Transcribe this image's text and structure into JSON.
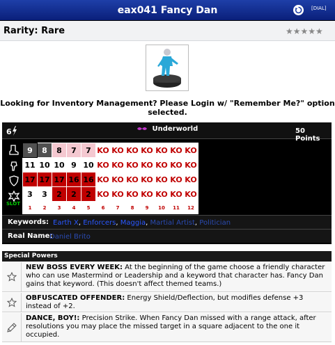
{
  "header": {
    "title": "eax041 Fancy Dan",
    "dial_label": "[DIAL]"
  },
  "rarity": {
    "text": "Rarity: Rare",
    "stars": "★★★★★"
  },
  "notice": {
    "line1": "Looking for Inventory Management? Please Login w/ \"Remember Me?\" option",
    "line2": "selected."
  },
  "dial": {
    "points_range": "6",
    "team": "Underworld",
    "cost": "50 Points",
    "slot_label": "SLOT",
    "rows": [
      [
        "9",
        "8",
        "8",
        "7",
        "7",
        "KO",
        "KO",
        "KO",
        "KO",
        "KO",
        "KO",
        "KO"
      ],
      [
        "11",
        "10",
        "10",
        "9",
        "10",
        "KO",
        "KO",
        "KO",
        "KO",
        "KO",
        "KO",
        "KO"
      ],
      [
        "17",
        "17",
        "17",
        "16",
        "16",
        "KO",
        "KO",
        "KO",
        "KO",
        "KO",
        "KO",
        "KO"
      ],
      [
        "3",
        "3",
        "2",
        "2",
        "2",
        "KO",
        "KO",
        "KO",
        "KO",
        "KO",
        "KO",
        "KO"
      ]
    ],
    "slots": [
      "1",
      "2",
      "3",
      "4",
      "5",
      "6",
      "7",
      "8",
      "9",
      "10",
      "11",
      "12"
    ]
  },
  "keywords": {
    "label": "Keywords:",
    "items": [
      {
        "text": "Earth X",
        "sep": ", "
      },
      {
        "text": "Enforcers",
        "sep": ", "
      },
      {
        "text": "Maggia",
        "sep": ", "
      },
      {
        "text": "Martial Artist",
        "sep": ", "
      },
      {
        "text": "Politician",
        "sep": ""
      }
    ]
  },
  "real_name": {
    "label": "Real Name:",
    "value": "Daniel Brito"
  },
  "special_powers": {
    "heading": "Special Powers",
    "powers": [
      {
        "name": "NEW BOSS EVERY WEEK:",
        "text": " At the beginning of the game choose a friendly character who can use Mastermind or Leadership and a keyword that character has. Fancy Dan gains that keyword. (This doesn't affect themed teams.)",
        "icon": "star-outline-icon"
      },
      {
        "name": "OBFUSCATED OFFENDER:",
        "text": " Energy Shield/Deflection, but modifies defense +3 instead of +2.",
        "icon": "star-outline-icon"
      },
      {
        "name": "DANCE, BOY!:",
        "text": " Precision Strike. When Fancy Dan missed with a range attack, after resolutions you may place the missed target in a square adjacent to the one it occupied.",
        "icon": "syringe-icon"
      }
    ]
  },
  "colors": {
    "title_bar": "#0a1f7a",
    "ko_text": "#c00000",
    "keyword_link": "#2a58ff",
    "team_icon": "#c038c8"
  }
}
